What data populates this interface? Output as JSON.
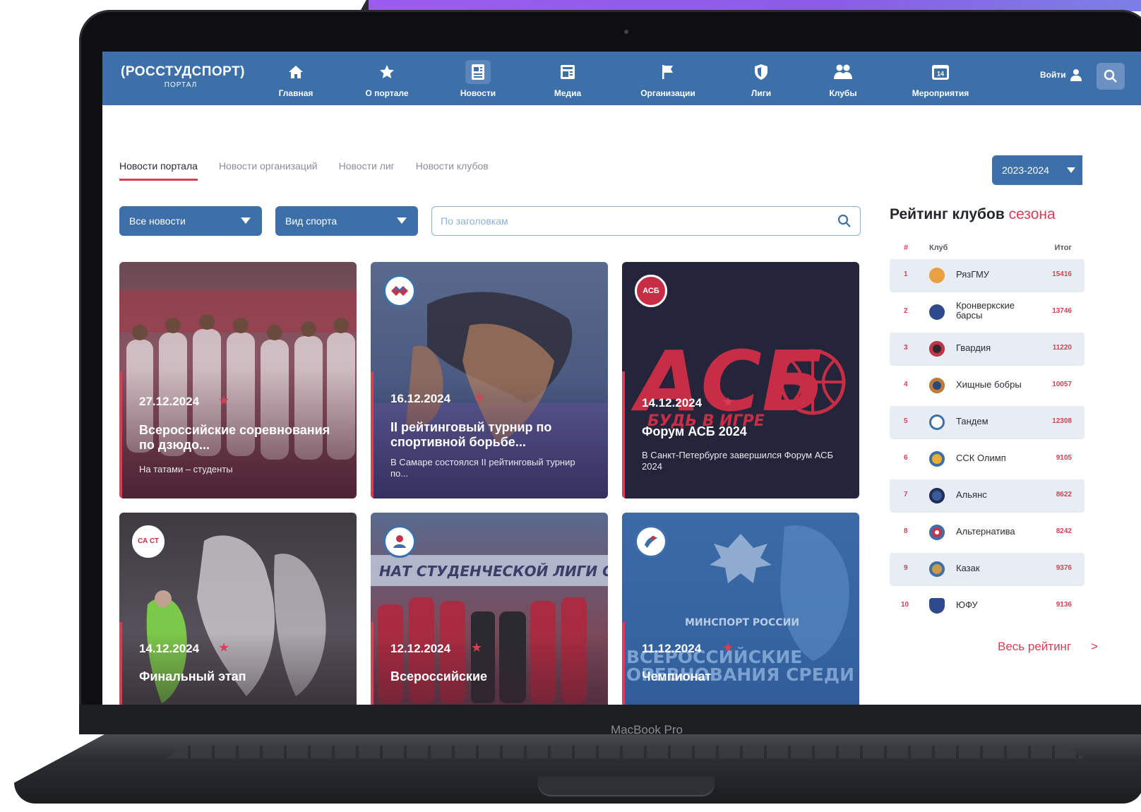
{
  "device": {
    "label": "MacBook Pro"
  },
  "brand": {
    "logo_main": "(РОССТУДСПОРТ)",
    "logo_sub": "ПОРТАЛ"
  },
  "nav": {
    "items": [
      {
        "label": "Главная",
        "icon": "home-icon"
      },
      {
        "label": "О портале",
        "icon": "star-icon"
      },
      {
        "label": "Новости",
        "icon": "news-icon",
        "active": true
      },
      {
        "label": "Медиа",
        "icon": "media-icon"
      },
      {
        "label": "Организации",
        "icon": "flag-icon"
      },
      {
        "label": "Лиги",
        "icon": "shield-icon"
      },
      {
        "label": "Клубы",
        "icon": "users-icon"
      },
      {
        "label": "Мероприятия",
        "icon": "calendar-icon",
        "calendar_day": "14"
      }
    ],
    "login_label": "Войти"
  },
  "tabs": [
    "Новости портала",
    "Новости организаций",
    "Новости лиг",
    "Новости клубов"
  ],
  "season": {
    "selected": "2023-2024"
  },
  "filters": {
    "news_type": "Все новости",
    "sport": "Вид спорта",
    "search_placeholder": "По заголовкам"
  },
  "cards": [
    {
      "date": "27.12.2024",
      "title": "Всероссийские соревнования по дзюдо...",
      "desc": "На татами – студенты"
    },
    {
      "date": "16.12.2024",
      "title": "II рейтинговый турнир по спортивной борьбе...",
      "desc": "В Самаре состоялся II рейтинговый турнир по...",
      "badge": ""
    },
    {
      "date": "14.12.2024",
      "title": "Форум АСБ 2024",
      "desc": "В Санкт-Петербурге завершился Форум АСБ 2024",
      "badge": "АСБ",
      "art_big": "АСБ",
      "art_small": "БУДЬ В ИГРЕ"
    },
    {
      "date": "14.12.2024",
      "title": "Финальный этап",
      "badge": "СА СТ"
    },
    {
      "date": "12.12.2024",
      "title": "Всероссийские",
      "banner": "НАТ СТУДЕНЧЕСКОЙ ЛИГИ САМБ"
    },
    {
      "date": "11.12.2024",
      "title": "Чемпионат",
      "art_text": "МИНСПОРТ РОССИИ",
      "art_overlay_1": "ВСЕРОССИЙСКИЕ",
      "art_overlay_2": "ОРЕВНОВАНИЯ СРЕДИ"
    }
  ],
  "rating": {
    "title": "Рейтинг клубов",
    "title_accent": "сезона",
    "columns": {
      "num": "#",
      "club": "Клуб",
      "total": "Итог"
    },
    "rows": [
      {
        "num": "1",
        "club": "РязГМУ",
        "score": "15416"
      },
      {
        "num": "2",
        "club": "Кронверкские барсы",
        "score": "13746"
      },
      {
        "num": "3",
        "club": "Гвардия",
        "score": "11220"
      },
      {
        "num": "4",
        "club": "Хищные бобры",
        "score": "10057"
      },
      {
        "num": "5",
        "club": "Тандем",
        "score": "12308"
      },
      {
        "num": "6",
        "club": "ССК Олимп",
        "score": "9105"
      },
      {
        "num": "7",
        "club": "Альянс",
        "score": "8622"
      },
      {
        "num": "8",
        "club": "Альтернатива",
        "score": "8242"
      },
      {
        "num": "9",
        "club": "Казак",
        "score": "9376"
      },
      {
        "num": "10",
        "club": "ЮФУ",
        "score": "9136"
      }
    ],
    "all_label": "Весь рейтинг",
    "all_arrow": ">"
  },
  "colors": {
    "primary": "#3d6fa8",
    "accent": "#d63f55",
    "purple": "#9b5cf0"
  }
}
